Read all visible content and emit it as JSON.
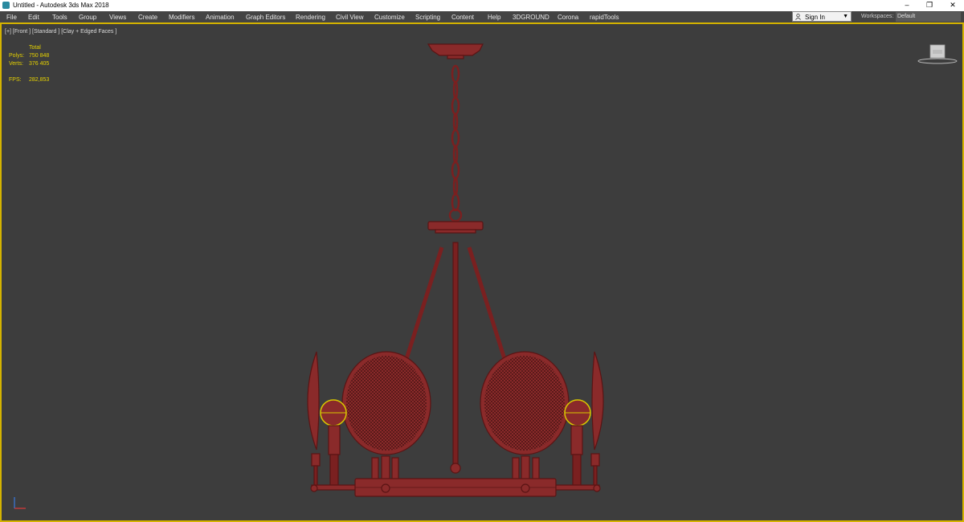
{
  "window": {
    "title": "Untitled - Autodesk 3ds Max 2018",
    "minimize": "–",
    "maximize": "❐",
    "close": "✕"
  },
  "menu": [
    "File",
    "Edit",
    "Tools",
    "Group",
    "Views",
    "Create",
    "Modifiers",
    "Animation",
    "Graph Editors",
    "Rendering",
    "Civil View",
    "Customize",
    "Scripting",
    "Content",
    "Help",
    "3DGROUND",
    "Corona",
    "rapidTools"
  ],
  "signin": {
    "label": "Sign In",
    "icon": "user-icon"
  },
  "workspaces": {
    "label": "Workspaces:",
    "value": "Default"
  },
  "viewport": {
    "label": "[+] [Front ] [Standard ] [Clay + Edged Faces ]",
    "stats": {
      "header": "Total",
      "polys_label": "Polys:",
      "polys": "750 848",
      "verts_label": "Verts:",
      "verts": "376 405",
      "fps_label": "FPS:",
      "fps": "282,853"
    },
    "accent": "#d4b300",
    "model_color": "#8a2a2a"
  }
}
